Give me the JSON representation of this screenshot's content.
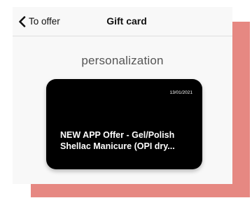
{
  "navbar": {
    "back_label": "To offer",
    "title": "Gift card"
  },
  "section": {
    "title": "personalization"
  },
  "gift_card": {
    "date": "13/01/2021",
    "offer_line_1": "NEW APP Offer - Gel/Polish",
    "offer_line_2": "Shellac Manicure (OPI dry..."
  },
  "colors": {
    "accent_block": "#e68882",
    "card_background": "#000000"
  },
  "icons": {
    "back": "chevron-left-icon"
  }
}
